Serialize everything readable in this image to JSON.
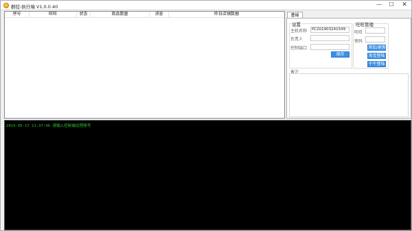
{
  "window": {
    "title": "群控-执行端 V1.0.0.40",
    "controls": {
      "minimize": "—",
      "maximize": "☐",
      "close": "✕"
    }
  },
  "grid": {
    "columns": [
      "序号",
      "旺旺",
      "状态",
      "商品数量",
      "消息",
      "昨日店铺数据"
    ]
  },
  "tabs": [
    {
      "label": "基础"
    }
  ],
  "settings": {
    "title": "设置",
    "host_label": "主机名称",
    "host_value": "PC201903241549",
    "owner_label": "负责人",
    "owner_value": "",
    "port_label": "控制端口",
    "port_value": "",
    "save_button": "保存"
  },
  "wangwang": {
    "title": "旺旺管理",
    "account_label": "旺旺",
    "account_value": "",
    "password_label": "密码",
    "password_value": "",
    "add_update_button": "添加/更新",
    "taobao_login_button": "淘宝登陆",
    "qianniu_login_button": "千牛登陆"
  },
  "remarks": {
    "label": "备注",
    "value": ""
  },
  "console": {
    "lines": [
      "2019-05-17 11:37:46 请输入控制端远程账号"
    ]
  },
  "colors": {
    "button_blue": "#3b8fe6",
    "console_bg": "#000000",
    "console_text": "#2ec52e"
  }
}
